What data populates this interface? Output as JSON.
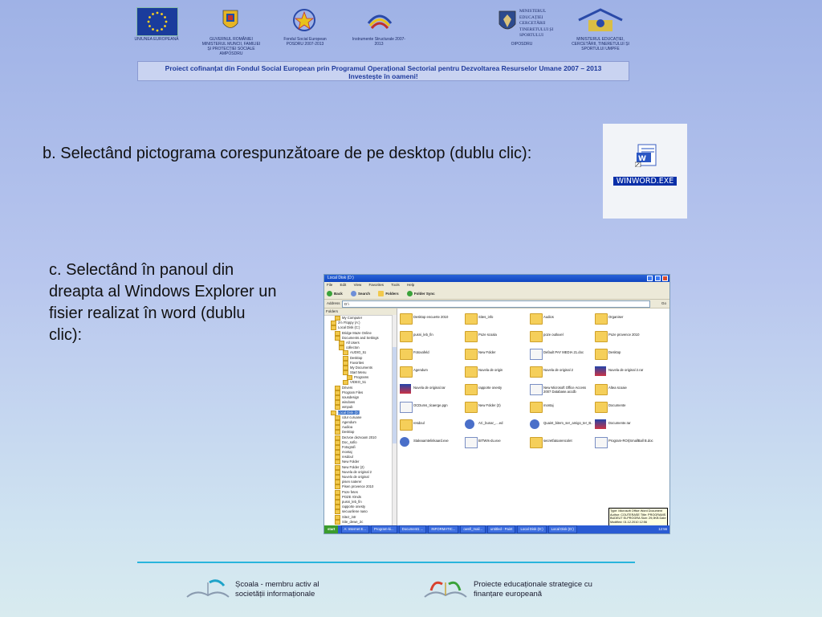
{
  "logos": [
    {
      "label": "UNIUNEA EUROPEANĂ"
    },
    {
      "label": "GUVERNUL ROMÂNIEI MINISTERUL MUNCII, FAMILIEI ȘI PROTECȚIEI SOCIALE AMPOSDRU"
    },
    {
      "label": "Fondul Social European POSDRU 2007-2013"
    },
    {
      "label": "Instrumente Structurale 2007-2013"
    },
    {
      "label": "MINISTERUL EDUCAȚIEI CERCETĂRII TINERETULUI ȘI SPORTULUI",
      "sub": "OIPOSDRU"
    },
    {
      "label": "MINISTERUL EDUCAȚIEI, CERCETĂRII, TINERETULUI ȘI SPORTULUI UMPFE"
    }
  ],
  "banner": {
    "line1": "Proiect cofinanțat din Fondul Social European prin Programul Operațional Sectorial pentru Dezvoltarea Resurselor Umane 2007 – 2013",
    "line2": "Investește în oameni!"
  },
  "step_b": "b. Selectând pictograma corespunzătoare de pe desktop (dublu clic):",
  "step_c": "c. Selectând în panoul din dreapta al Windows Explorer un fisier realizat în word (dublu clic):",
  "winword_icon": {
    "caption": "WINWORD.EXE",
    "name": "word-app-icon"
  },
  "explorer": {
    "title": "Local Disk (D:)",
    "menu": [
      "File",
      "Edit",
      "View",
      "Favorites",
      "Tools",
      "Help"
    ],
    "toolbar": [
      "Back",
      "Search",
      "Folders",
      "Folder Sync"
    ],
    "address_label": "Address",
    "address_value": "D:\\",
    "go_label": "Go",
    "tree_header": "Folders",
    "tree": [
      "My Computer",
      "3½ Floppy (A:)",
      "Local Disk (C:)",
      "Bridge Maze Online",
      "Documents and Settings",
      "All Users",
      "collecton",
      "AUDIO_51",
      "Desktop",
      "Favorites",
      "My Documents",
      "Start Menu",
      "Programs",
      "VIDEO_51",
      "Drivers",
      "Program Files",
      "sousdesign",
      "windows",
      "wmpub",
      "Local Disk (D:)",
      "cdur curuane",
      "Agendum",
      "Audioa",
      "Desktop",
      "Dezvoe dezvoam 2010",
      "Doc_sofio",
      "Fotografi",
      "montaj",
      "resdoul",
      "New Folder",
      "New Folder (2)",
      "Nuvela de original 2",
      "Nuvelo de original",
      "pisen naterer",
      "Pisen provence 2010",
      "Poze fetes",
      "POZE rOnds",
      "pusni_leb_fin",
      "rapporte onesty",
      "secuurilene naso",
      "Sitez_intr",
      "Site_dewe_2c"
    ],
    "files": [
      {
        "name": "Desktop encuerte 2010",
        "type": "folder"
      },
      {
        "name": "Sites_info",
        "type": "folder"
      },
      {
        "name": "Audios",
        "type": "folder"
      },
      {
        "name": "Organiser",
        "type": "folder"
      },
      {
        "name": "pusni_leb_fin",
        "type": "folder"
      },
      {
        "name": "Poze scoala",
        "type": "folder"
      },
      {
        "name": "poze outluvel",
        "type": "folder"
      },
      {
        "name": "Poze provence 2010",
        "type": "folder"
      },
      {
        "name": "Fotoxafeld",
        "type": "folder"
      },
      {
        "name": "New Folder",
        "type": "folder"
      },
      {
        "name": "Default PAY MEDIA 21.doc",
        "type": "doc"
      },
      {
        "name": "Desktop",
        "type": "folder"
      },
      {
        "name": "Agendum",
        "type": "folder"
      },
      {
        "name": "Nuvela de origin",
        "type": "folder"
      },
      {
        "name": "Nuvela de original 2",
        "type": "folder"
      },
      {
        "name": "Nuvela de original 2.rar",
        "type": "img"
      },
      {
        "name": "Nuvela de original.rar",
        "type": "img"
      },
      {
        "name": "rapporte onesty",
        "type": "folder"
      },
      {
        "name": "New Microsoft Office Access 2007 Database.accdb",
        "type": "doc"
      },
      {
        "name": "Altea scoaie",
        "type": "folder"
      },
      {
        "name": "OCDums_ticaerge.pgn",
        "type": "doc"
      },
      {
        "name": "New Folder (2)",
        "type": "folder"
      },
      {
        "name": "montaj",
        "type": "folder"
      },
      {
        "name": "Documente",
        "type": "folder"
      },
      {
        "name": "resdoul",
        "type": "folder"
      },
      {
        "name": "AC_bunar_....ed",
        "type": "bs"
      },
      {
        "name": "Quaint_bitem_ser_amigo_ter_B...",
        "type": "bs"
      },
      {
        "name": "Documente.rar",
        "type": "img"
      },
      {
        "name": "Staleaamtelinkaard.exe",
        "type": "bs"
      },
      {
        "name": "BITWIs-du.exe",
        "type": "doc"
      },
      {
        "name": "secretfatoarencolet",
        "type": "folder"
      },
      {
        "name": "Program-ROI(SmallBall B.doc",
        "type": "doc"
      }
    ],
    "tooltip": "Type: Microsoft Office Word Document Author: COUTERASE Title: PROGRAMS BUDEUT ELPROGRA Size: 29,0KB Date Modified: 01.12.2010 12:56",
    "taskbar": {
      "start": "start",
      "tasks": [
        "A: Internet E...",
        "Program-ki...",
        "Document1 ...",
        "INFORMATIC...",
        "ownll_mail...",
        "untitled - Paint",
        "Local Disk (D:)",
        "Local Disk (D:)"
      ],
      "clock": "12:56"
    }
  },
  "footer": {
    "left": "Școala - membru activ al societății informaționale",
    "right": "Proiecte educaționale strategice cu finanțare europeană"
  },
  "colors": {
    "background_top": "#9fb2e6",
    "background_bottom": "#d8ebef",
    "banner_text": "#1e3a9c",
    "accent_line": "#28b4dc"
  }
}
